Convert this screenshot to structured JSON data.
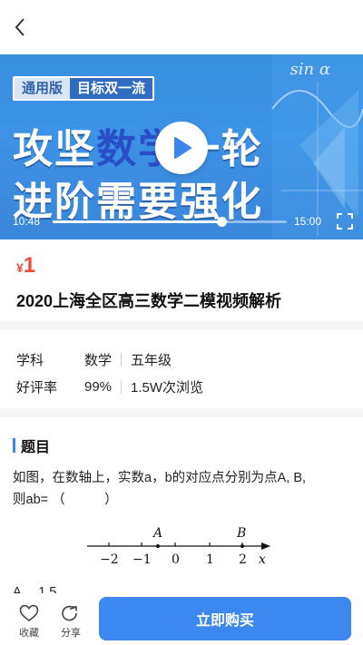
{
  "header": {
    "back_icon": "chevron-left-icon"
  },
  "video": {
    "tag_general": "通用版",
    "tag_goal": "目标双一流",
    "banner_line1_a": "攻坚",
    "banner_line1_b": "数学",
    "banner_line1_c": "一轮",
    "banner_line2": "进阶需要强化",
    "math_label": "sin α",
    "current_time": "10:48",
    "total_time": "15:00",
    "progress": 0.72,
    "colors": {
      "accent": "#3a8fe0",
      "highlight": "#2b4ec8"
    }
  },
  "course": {
    "currency": "¥",
    "price": "1",
    "title": "2020上海全区高三数学二模视频解析",
    "price_color": "#f04a3e"
  },
  "meta": {
    "subject_label": "学科",
    "subject_value": "数学",
    "grade_value": "五年级",
    "rating_label": "好评率",
    "rating_value": "99%",
    "views_value": "1.5W次浏览"
  },
  "question": {
    "section_title": "题目",
    "text_line1": "如图，在数轴上，实数a，b的对应点分别为点A, B,",
    "text_line2": "则ab= （　　　）",
    "number_line": {
      "ticks": [
        "−2",
        "−1",
        "0",
        "1",
        "2"
      ],
      "point_a": "A",
      "point_b": "B",
      "axis_label": "x"
    },
    "option_a": "A、 1.5"
  },
  "bottom": {
    "favorite_label": "收藏",
    "share_label": "分享",
    "buy_label": "立即购买",
    "buy_color": "#3d88f0"
  }
}
